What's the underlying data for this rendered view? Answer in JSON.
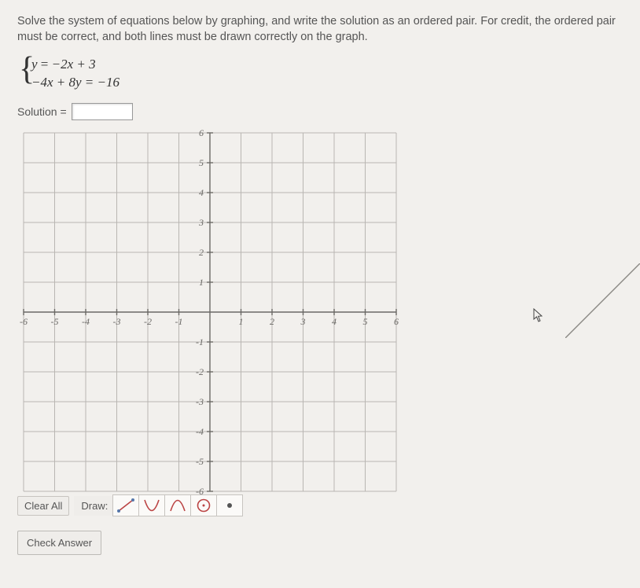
{
  "instructions": "Solve the system of equations below by graphing, and write the solution as an ordered pair. For credit, the ordered pair must be correct, and both lines must be drawn correctly on the graph.",
  "equations": {
    "line1_y": "y",
    "line1_eq": " = ",
    "line1_rhs": "−2x + 3",
    "line2": "−4x + 8y = −16"
  },
  "solution_label": "Solution =",
  "solution_value": "",
  "toolbar": {
    "clear": "Clear All",
    "draw": "Draw:",
    "tool_line": "line",
    "tool_up_parabola": "up-parabola",
    "tool_down_parabola": "down-parabola",
    "tool_circle": "circle",
    "tool_point": "point"
  },
  "check_label": "Check Answer",
  "chart_data": {
    "type": "blank-coordinate-grid",
    "xlim": [
      -6,
      6
    ],
    "ylim": [
      -6,
      6
    ],
    "x_ticks": [
      -6,
      -5,
      -4,
      -3,
      -2,
      -1,
      1,
      2,
      3,
      4,
      5,
      6
    ],
    "y_ticks": [
      -6,
      -5,
      -4,
      -3,
      -2,
      -1,
      1,
      2,
      3,
      4,
      5,
      6
    ],
    "grid": true
  }
}
